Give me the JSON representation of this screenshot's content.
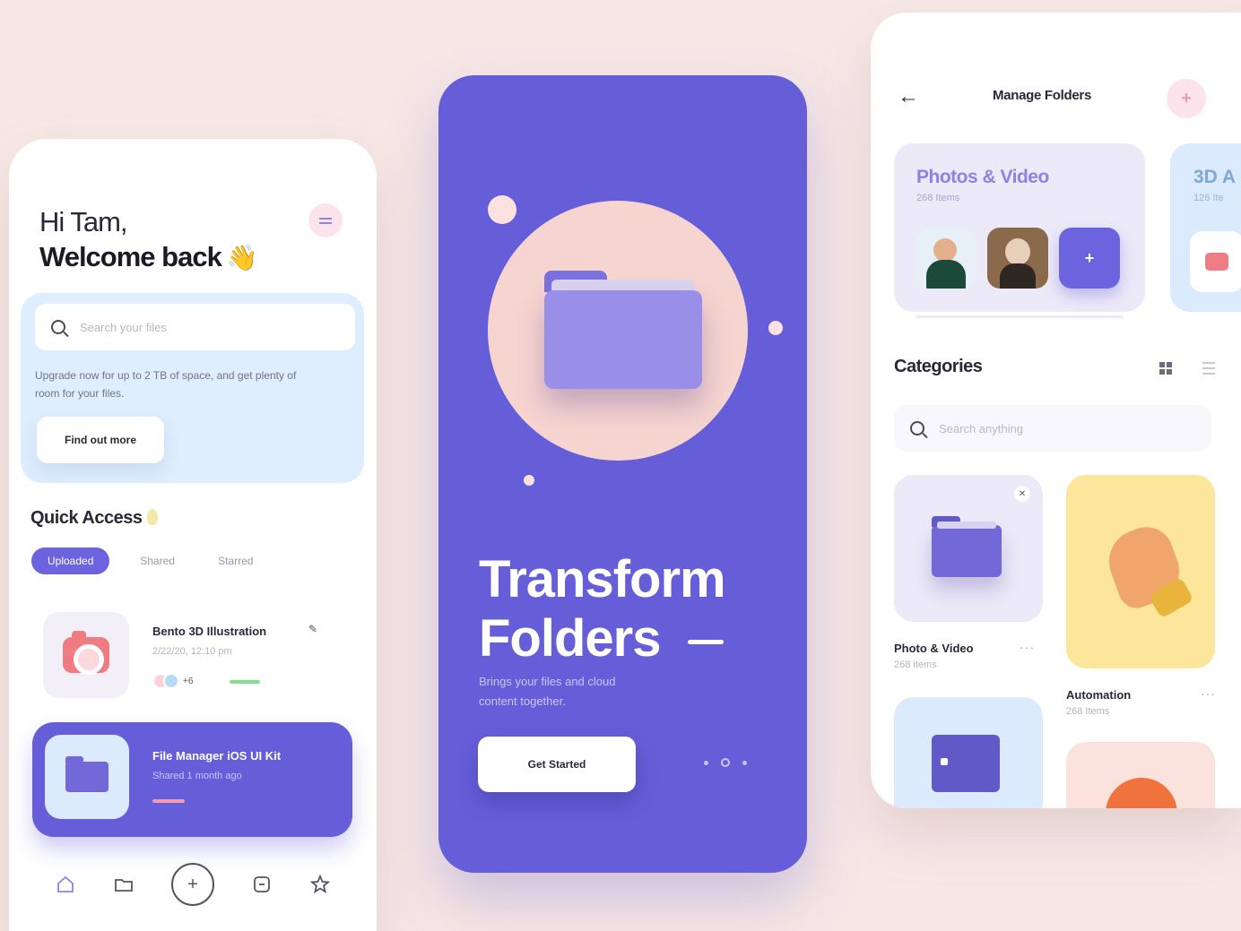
{
  "left_phone": {
    "greeting_hi": "Hi Tam,",
    "greeting_welcome": "Welcome back",
    "wave_emoji": "👋",
    "search_placeholder": "Search your files",
    "upgrade_text": "Upgrade now for up to 2 TB of space, and get plenty of room for your files.",
    "find_out_more": "Find out more",
    "quick_access_title": "Quick Access",
    "tabs": [
      "Uploaded",
      "Shared",
      "Starred"
    ],
    "file_item": {
      "name": "Bento 3D Illustration",
      "date": "2/22/20, 12:10 pm",
      "more_count": "+6"
    },
    "file_card": {
      "title": "File Manager iOS UI Kit",
      "subtitle": "Shared 1 month ago"
    },
    "tabbar_icons": [
      "home-icon",
      "folder-icon",
      "add-icon",
      "chat-icon",
      "star-icon"
    ]
  },
  "middle_phone": {
    "title_line1": "Transform",
    "title_line2": "Folders",
    "subtitle": "Brings your files and cloud content together.",
    "cta": "Get Started"
  },
  "right_phone": {
    "header_title": "Manage Folders",
    "add_symbol": "+",
    "folder_card_1": {
      "title": "Photos & Video",
      "count": "268 Items"
    },
    "folder_card_2": {
      "title": "3D A",
      "count": "126 Ite"
    },
    "categories_title": "Categories",
    "search_placeholder": "Search anything",
    "categories": [
      {
        "label": "Photo & Video",
        "count": "268 items"
      },
      {
        "label": "Automation",
        "count": "268 Items"
      }
    ]
  },
  "colors": {
    "background": "#f6e7e5",
    "primary": "#665ed9",
    "light_blue": "#dfeefe",
    "lavender": "#ece9f8",
    "yellow": "#fbe69b",
    "pink": "#fde3ec"
  }
}
